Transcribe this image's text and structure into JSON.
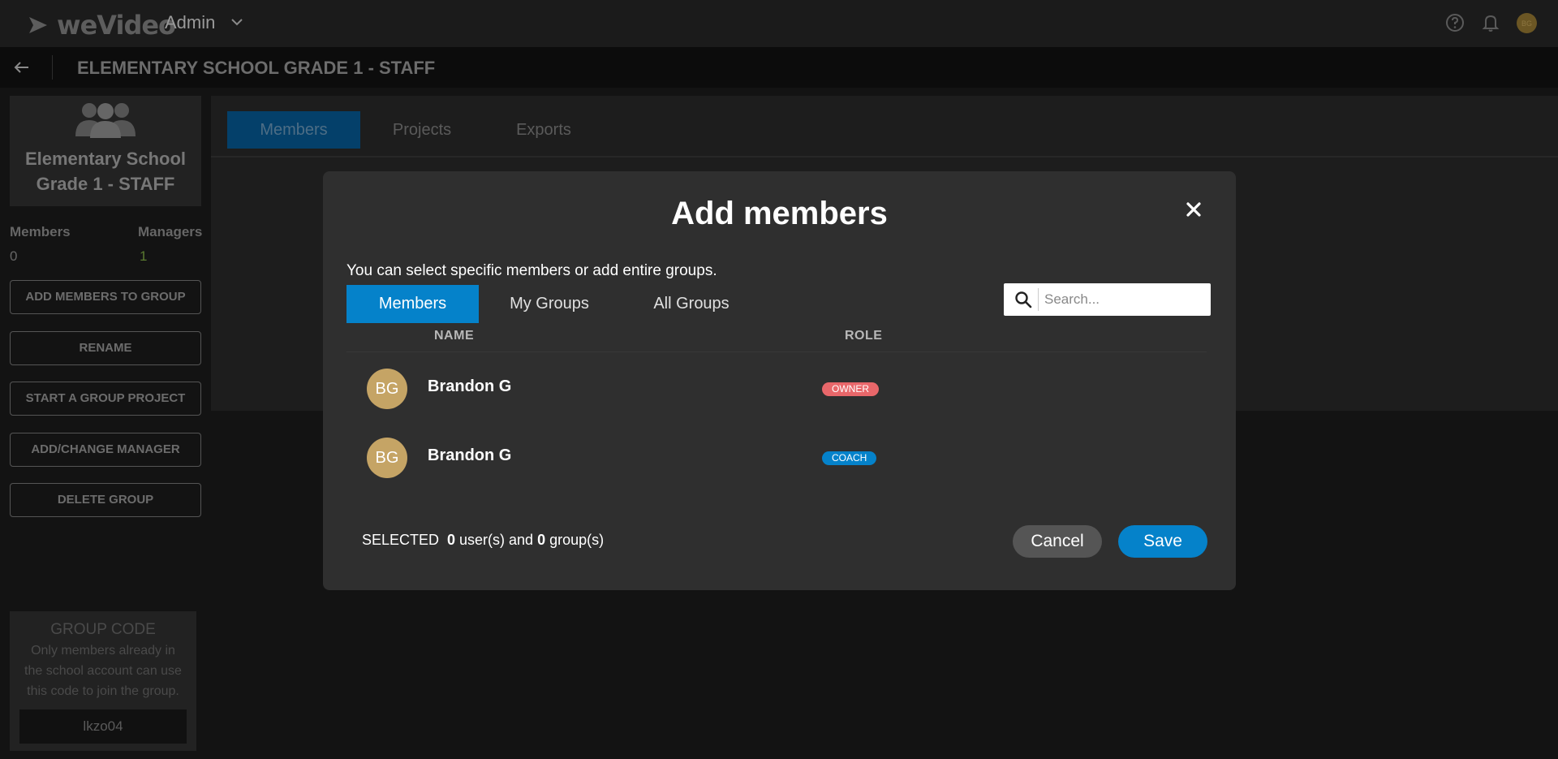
{
  "topbar": {
    "logo_text": "weVideo",
    "admin_label": "Admin",
    "avatar_initials": "BG"
  },
  "titlebar": {
    "title": "ELEMENTARY SCHOOL GRADE 1 - STAFF"
  },
  "sidebar": {
    "group_name_line1": "Elementary School",
    "group_name_line2": "Grade 1 - STAFF",
    "members_label": "Members",
    "members_value": "0",
    "managers_label": "Managers",
    "managers_value": "1",
    "buttons": [
      "ADD MEMBERS TO GROUP",
      "RENAME",
      "START A GROUP PROJECT",
      "ADD/CHANGE MANAGER",
      "DELETE GROUP"
    ],
    "group_code": {
      "title": "GROUP CODE",
      "desc_line1": "Only members already in",
      "desc_line2": "the school account can use",
      "desc_line3": "this code to join the group.",
      "code": "lkzo04"
    }
  },
  "main": {
    "tabs": [
      "Members",
      "Projects",
      "Exports"
    ]
  },
  "modal": {
    "title": "Add members",
    "description": "You can select specific members or add entire groups.",
    "tabs": [
      "Members",
      "My Groups",
      "All Groups"
    ],
    "search_placeholder": "Search...",
    "columns": {
      "name": "NAME",
      "role": "ROLE"
    },
    "members": [
      {
        "initials": "BG",
        "name": "Brandon G",
        "role": "OWNER",
        "role_color": "#e8676a"
      },
      {
        "initials": "BG",
        "name": "Brandon G",
        "role": "COACH",
        "role_color": "#0582ca"
      }
    ],
    "footer": {
      "selected_label": "SELECTED",
      "users_count": "0",
      "users_text": "user(s) and",
      "groups_count": "0",
      "groups_text": "group(s)"
    },
    "cancel_label": "Cancel",
    "save_label": "Save"
  },
  "colors": {
    "accent": "#0582ca",
    "owner_badge": "#e8676a",
    "avatar": "#c5a465"
  }
}
